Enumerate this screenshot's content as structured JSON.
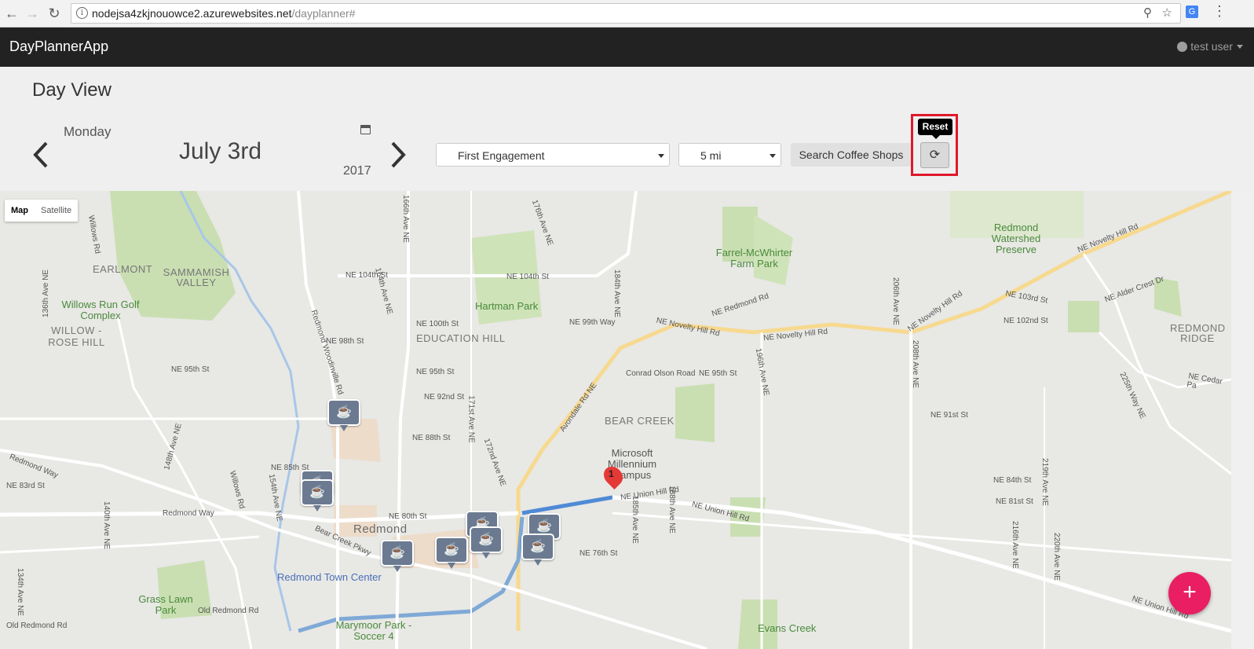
{
  "browser": {
    "url_host": "nodejsa4zkjnouowce2.azurewebsites.net",
    "url_path": "/dayplanner#"
  },
  "navbar": {
    "brand": "DayPlannerApp",
    "user": "test user"
  },
  "header": {
    "title": "Day View",
    "weekday": "Monday",
    "month_day": "July 3rd",
    "year": "2017",
    "engagement_select": "First Engagement",
    "distance_select": "5 mi",
    "search_button": "Search Coffee Shops",
    "reset_tooltip": "Reset"
  },
  "map": {
    "type_map": "Map",
    "type_satellite": "Satellite",
    "route_marker_label": "1",
    "places": {
      "earlmont": "EARLMONT",
      "sammamish_valley": "SAMMAMISH VALLEY",
      "willow_rose_hill": "WILLOW - ROSE HILL",
      "education_hill": "EDUCATION HILL",
      "bear_creek": "BEAR CREEK",
      "redmond": "Redmond",
      "redmond_ridge": "REDMOND RIDGE"
    },
    "parks": {
      "willows_run": "Willows Run Golf Complex",
      "hartman_park": "Hartman Park",
      "farrel_mcwhirter": "Farrel-McWhirter Farm Park",
      "redmond_watershed": "Redmond Watershed Preserve",
      "grass_lawn": "Grass Lawn Park",
      "marymoor": "Marymoor Park - Soccer 4",
      "evans_creek": "Evans Creek"
    },
    "poi": {
      "microsoft": "Microsoft Millennium Campus",
      "town_center": "Redmond Town Center"
    },
    "streets": {
      "ne_novelty_1": "NE Novelty Hill Rd",
      "ne_novelty_2": "NE Novelty Hill Rd",
      "ne_novelty_3": "NE Novelty Hill Rd",
      "ne_novelty_4": "NE Novelty Hill Rd",
      "ne_union_hill_1": "NE Union Hill Rd",
      "ne_union_hill_2": "NE Union Hill Rd",
      "ne_union_hill_3": "NE Union Hill Rd",
      "avondale": "Avondale Rd NE",
      "ne_104th": "NE 104th St",
      "ne_104th_w": "NE 104th St",
      "ne_100th": "NE 100th St",
      "ne_98th": "NE 98th St",
      "ne_95th": "NE 95th St",
      "ne_95th_w": "NE 95th St",
      "ne_95th_e": "NE 95th St",
      "ne_92nd": "NE 92nd St",
      "ne_88th": "NE 88th St",
      "ne_85th": "NE 85th St",
      "ne_83rd": "NE 83rd St",
      "ne_80th": "NE 80th St",
      "ne_76th": "NE 76th St",
      "ne_91st": "NE 91st St",
      "ne_84th": "NE 84th St",
      "ne_81st": "NE 81st St",
      "ne_redmond_rd": "NE Redmond Rd",
      "ne_99th_way": "NE 99th Way",
      "conrad_olson": "Conrad Olson Road",
      "redmond_way": "Redmond Way",
      "redmond_way_w": "Redmond Way",
      "bear_creek_pkwy": "Bear Creek Pkwy",
      "old_redmond_rd": "Old Redmond Rd",
      "old_redmond_rd_w": "Old Redmond Rd",
      "willows_rd": "Willows Rd",
      "willows_rd_s": "Willows Rd",
      "redmond_woodinville": "Redmond Woodinville Rd",
      "ave_166th": "166th Ave NE",
      "ave_164th": "164th Ave NE",
      "ave_171st": "171st Ave NE",
      "ave_172nd": "172nd Ave NE",
      "ave_176th": "176th Ave NE",
      "ave_184th": "184th Ave NE",
      "ave_185th": "185th Ave NE",
      "ave_188th": "188th Ave NE",
      "ave_196th": "196th Ave NE",
      "ave_206th": "206th Ave NE",
      "ave_208th": "208th Ave NE",
      "ave_148th": "148th Ave NE",
      "ave_154th": "154th Ave NE",
      "ave_140th": "140th Ave NE",
      "ave_134th": "134th Ave NE",
      "ave_136th": "136th Ave NE",
      "ave_216th": "216th Ave NE",
      "ave_219th": "219th Ave NE",
      "ave_220th": "220th Ave NE",
      "ave_225th": "225th Way NE",
      "ne_alder": "NE Alder Crest Dr",
      "ne_cedar": "NE Cedar Pa",
      "ne_103rd": "NE 103rd St",
      "ne_102nd": "NE 102nd St"
    },
    "fab_label": "+"
  },
  "icons": {
    "back": "back-arrow-icon",
    "forward": "forward-arrow-icon",
    "reload": "reload-icon",
    "calendar": "calendar-icon",
    "reset": "refresh-icon",
    "coffee": "coffee-cup-icon"
  }
}
